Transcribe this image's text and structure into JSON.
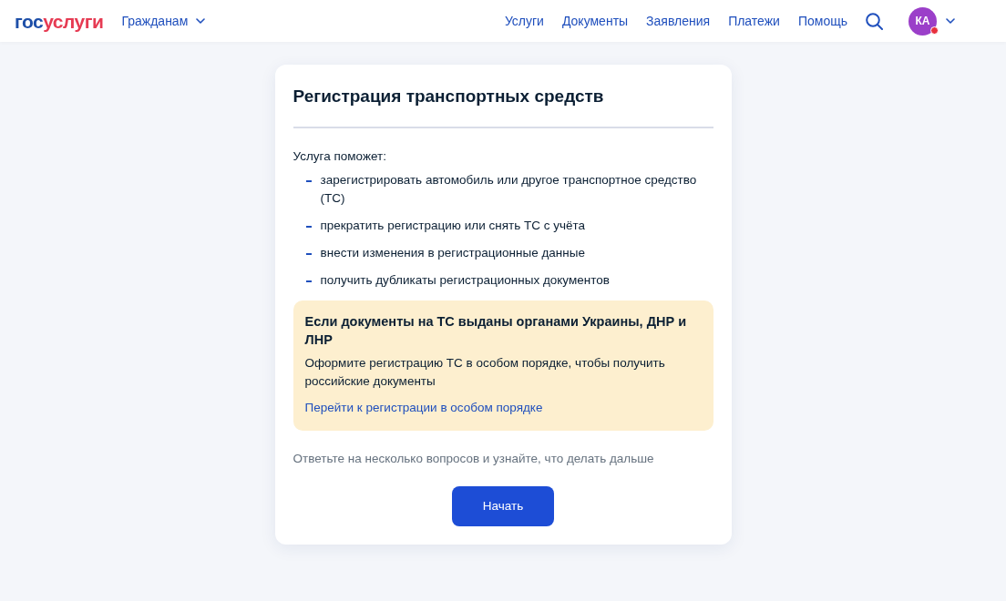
{
  "header": {
    "logo": [
      "гос",
      "услуги"
    ],
    "audience_menu": {
      "label": "Гражданам"
    },
    "nav": [
      "Услуги",
      "Документы",
      "Заявления",
      "Платежи",
      "Помощь"
    ],
    "avatar": {
      "initials": "КА",
      "notification": true
    }
  },
  "card": {
    "title": "Регистрация транспортных средств",
    "intro": "Услуга поможет:",
    "items": [
      "зарегистрировать автомобиль или другое транспортное средство (ТС)",
      "прекратить регистрацию или снять ТС с учёта",
      "внести изменения в регистрационные данные",
      "получить дубликаты регистрационных документов"
    ],
    "notice": {
      "title": "Если документы на ТС выданы органами Украины, ДНР и ЛНР",
      "text": "Оформите регистрацию ТС в особом порядке, чтобы получить российские документы",
      "link": "Перейти к регистрации в особом порядке"
    },
    "hint": "Ответьте на несколько вопросов и узнайте, что делать дальше",
    "button": "Начать"
  }
}
